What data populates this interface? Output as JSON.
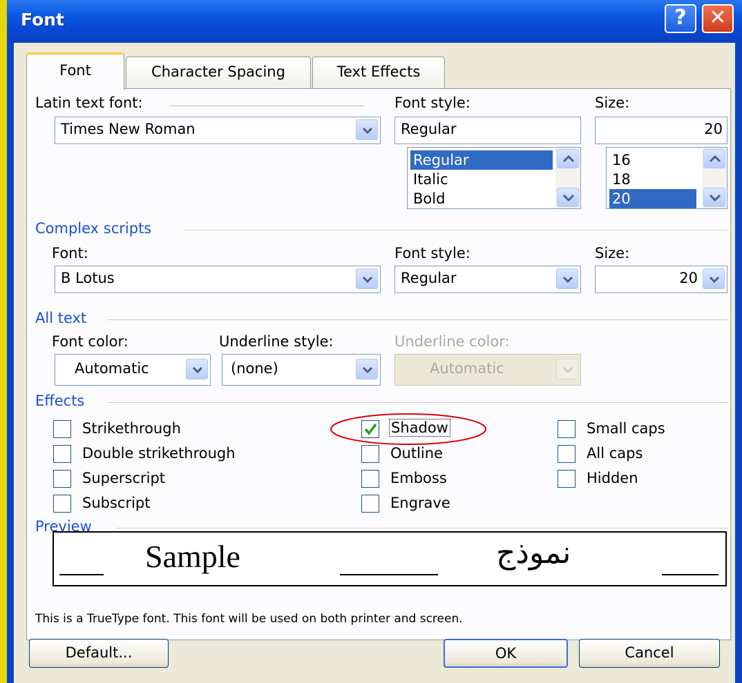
{
  "window": {
    "title": "Font",
    "help_glyph": "?",
    "close_glyph": "✕"
  },
  "tabs": [
    {
      "label": "Font"
    },
    {
      "label": "Character Spacing"
    },
    {
      "label": "Text Effects"
    }
  ],
  "latin": {
    "font_label": "Latin text font:",
    "font_value": "Times New Roman",
    "style_label": "Font style:",
    "style_value": "Regular",
    "style_options": [
      "Regular",
      "Italic",
      "Bold"
    ],
    "style_selected": "Regular",
    "size_label": "Size:",
    "size_value": "20",
    "size_options": [
      "16",
      "18",
      "20"
    ],
    "size_selected": "20"
  },
  "complex": {
    "group_title": "Complex scripts",
    "font_label": "Font:",
    "font_value": "B Lotus",
    "style_label": "Font style:",
    "style_value": "Regular",
    "size_label": "Size:",
    "size_value": "20"
  },
  "all_text": {
    "group_title": "All text",
    "font_color_label": "Font color:",
    "font_color_value": "Automatic",
    "underline_style_label": "Underline style:",
    "underline_style_value": "(none)",
    "underline_color_label": "Underline color:",
    "underline_color_value": "Automatic"
  },
  "effects": {
    "group_title": "Effects",
    "items": [
      {
        "label": "Strikethrough",
        "checked": false
      },
      {
        "label": "Double strikethrough",
        "checked": false
      },
      {
        "label": "Superscript",
        "checked": false
      },
      {
        "label": "Subscript",
        "checked": false
      },
      {
        "label": "Shadow",
        "checked": true
      },
      {
        "label": "Outline",
        "checked": false
      },
      {
        "label": "Emboss",
        "checked": false
      },
      {
        "label": "Engrave",
        "checked": false
      },
      {
        "label": "Small caps",
        "checked": false
      },
      {
        "label": "All caps",
        "checked": false
      },
      {
        "label": "Hidden",
        "checked": false
      }
    ]
  },
  "preview": {
    "group_title": "Preview",
    "latin_sample": "Sample",
    "complex_sample": "نموذج",
    "note": "This is a TrueType font. This font will be used on both printer and screen."
  },
  "buttons": {
    "default": "Default...",
    "ok": "OK",
    "cancel": "Cancel"
  },
  "colors": {
    "title_bar": "#0a58e2",
    "dialog_bg": "#ece9d8",
    "group_title": "#1a4fd6",
    "selection": "#316ac5",
    "annotation": "#e00000",
    "outer_bg": "#e6d60c"
  }
}
